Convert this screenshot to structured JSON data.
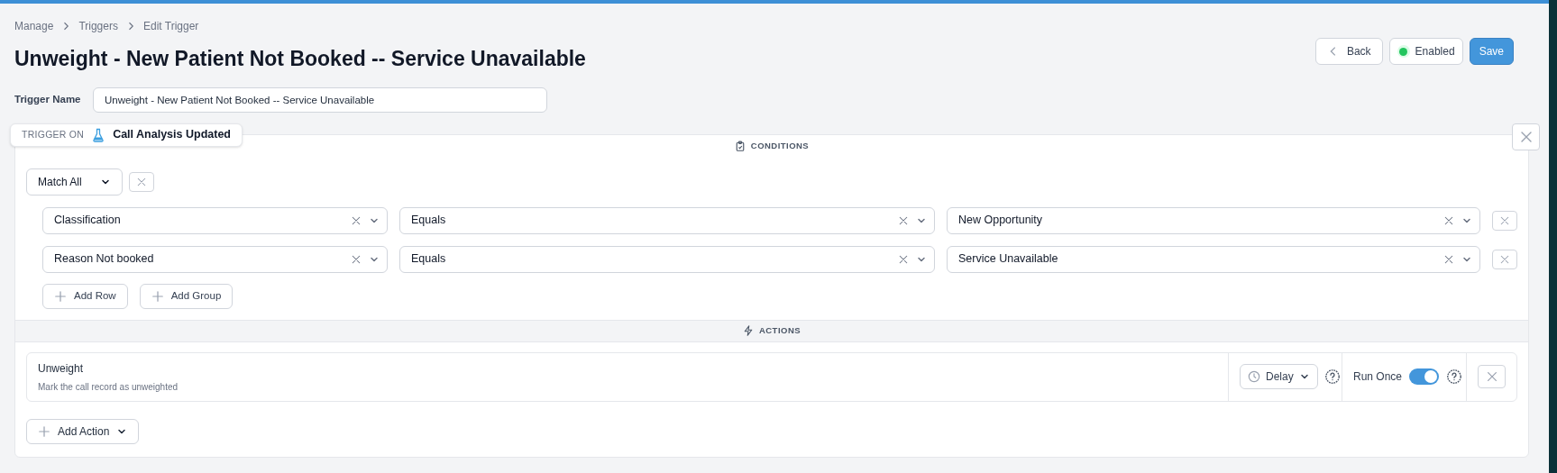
{
  "breadcrumb": [
    "Manage",
    "Triggers",
    "Edit Trigger"
  ],
  "title": "Unweight - New Patient Not Booked -- Service Unavailable",
  "header_buttons": {
    "back": "Back",
    "status": {
      "label": "Enabled",
      "on": true
    },
    "save": "Save"
  },
  "trigger_name": {
    "label": "Trigger Name",
    "value": "Unweight - New Patient Not Booked -- Service Unavailable"
  },
  "trigger_on": {
    "label": "TRIGGER ON",
    "event": "Call Analysis Updated"
  },
  "conditions": {
    "heading": "CONDITIONS",
    "match": "Match All",
    "rows": [
      {
        "field": "Classification",
        "operator": "Equals",
        "value": "New Opportunity"
      },
      {
        "field": "Reason Not booked",
        "operator": "Equals",
        "value": "Service Unavailable"
      }
    ],
    "add_row": "Add Row",
    "add_group": "Add Group"
  },
  "actions": {
    "heading": "ACTIONS",
    "items": [
      {
        "title": "Unweight",
        "description": "Mark the call record as unweighted",
        "delay": "Delay",
        "run_once_label": "Run Once",
        "run_once": true
      }
    ],
    "add_action": "Add Action"
  }
}
